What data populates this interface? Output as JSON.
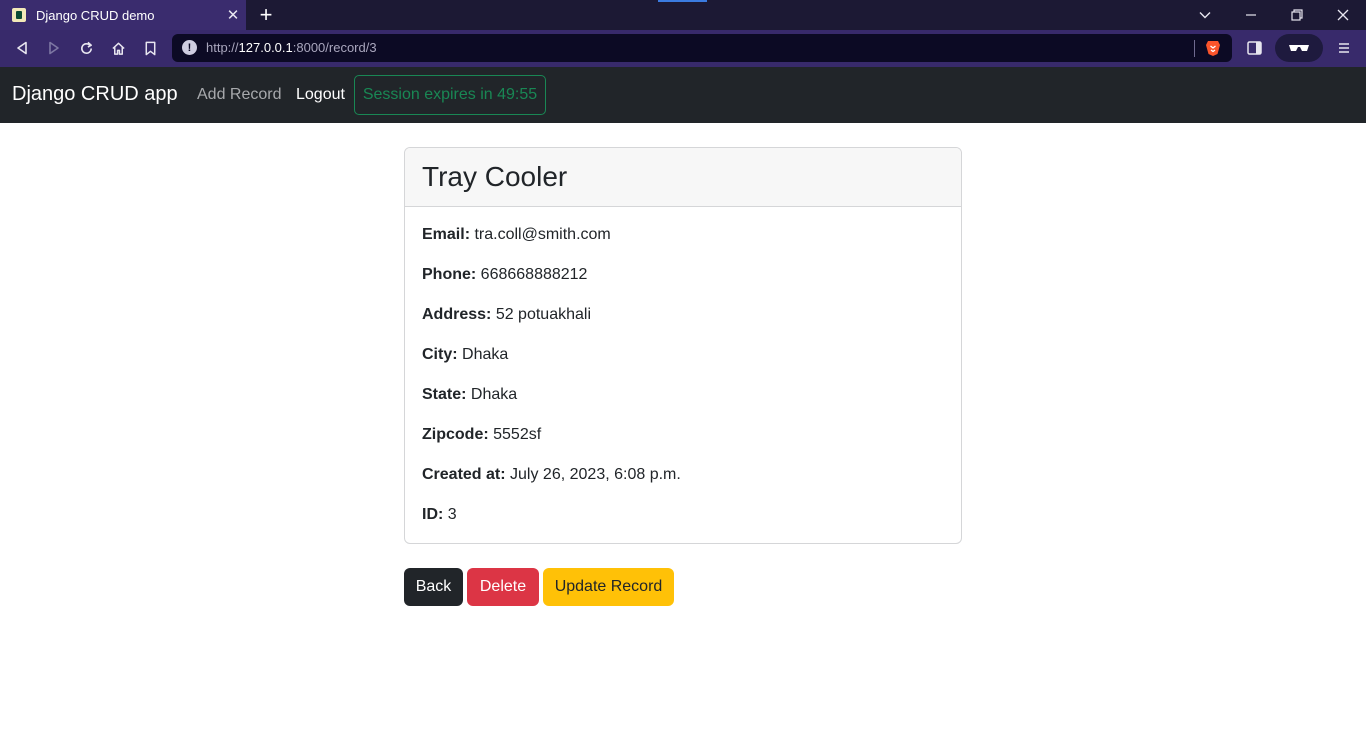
{
  "browser": {
    "tab_title": "Django CRUD demo",
    "tab_close": "✕",
    "new_tab": "+",
    "url_host": "127.0.0.1",
    "url_prefix": "http://",
    "url_suffix": ":8000/record/3"
  },
  "navbar": {
    "brand": "Django CRUD app",
    "add_record": "Add Record",
    "logout": "Logout",
    "session": "Session expires in 49:55"
  },
  "record": {
    "name": "Tray Cooler",
    "fields": [
      {
        "label": "Email:",
        "value": "tra.coll@smith.com"
      },
      {
        "label": "Phone:",
        "value": "668668888212"
      },
      {
        "label": "Address:",
        "value": "52 potuakhali"
      },
      {
        "label": "City:",
        "value": "Dhaka"
      },
      {
        "label": "State:",
        "value": "Dhaka"
      },
      {
        "label": "Zipcode:",
        "value": "5552sf"
      },
      {
        "label": "Created at:",
        "value": "July 26, 2023, 6:08 p.m."
      },
      {
        "label": "ID:",
        "value": "3"
      }
    ]
  },
  "actions": {
    "back": "Back",
    "delete": "Delete",
    "update": "Update Record"
  },
  "colors": {
    "tab_strip": "#1c1934",
    "address_bar": "#382a6b",
    "navbar": "#212529",
    "session_badge": "#198754",
    "back_button": "#212529",
    "delete_button": "#dc3545",
    "update_button": "#ffc107"
  },
  "icons": {
    "back": "arrow-left-icon",
    "forward": "arrow-right-icon",
    "reload": "reload-icon",
    "home": "home-icon",
    "bookmark": "bookmark-icon",
    "site_info": "info-icon",
    "brave_shields": "brave-lion-icon",
    "sidebar": "sidebar-icon",
    "wallet": "wallet-glasses-icon",
    "menu": "hamburger-menu-icon"
  }
}
